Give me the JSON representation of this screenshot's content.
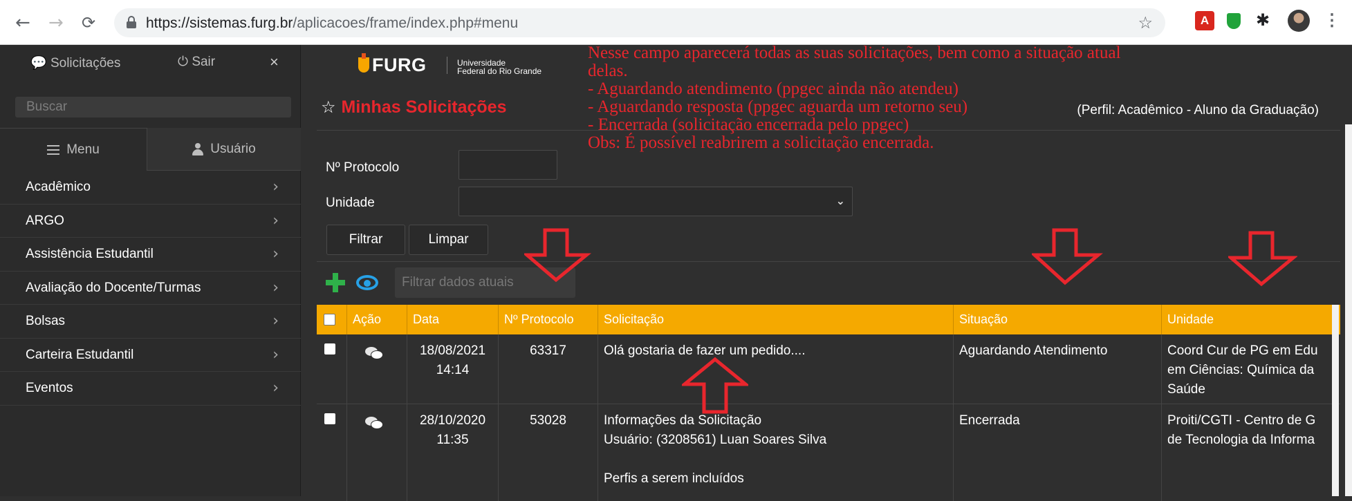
{
  "browser": {
    "url_host": "https://sistemas.furg.br",
    "url_path": "/aplicacoes/frame/index.php#menu",
    "pdf_ext_label": "A"
  },
  "sidebar": {
    "solicitacoes_label": "Solicitações",
    "sair_label": "Sair",
    "close_glyph": "×",
    "search_placeholder": "Buscar",
    "tab_menu": "Menu",
    "tab_usuario": "Usuário",
    "items": [
      {
        "label": "Acadêmico"
      },
      {
        "label": "ARGO"
      },
      {
        "label": "Assistência Estudantil"
      },
      {
        "label": "Avaliação do Docente/Turmas"
      },
      {
        "label": "Bolsas"
      },
      {
        "label": "Carteira Estudantil"
      },
      {
        "label": "Eventos"
      }
    ]
  },
  "header": {
    "logo_text": "FURG",
    "university_line1": "Universidade",
    "university_line2": "Federal do Rio Grande",
    "page_title": "Minhas Solicitações",
    "perfil": "(Perfil: Acadêmico - Aluno da Graduação)"
  },
  "filters": {
    "protocolo_label": "Nº Protocolo",
    "protocolo_value": "",
    "unidade_label": "Unidade",
    "unidade_value": "",
    "filtrar_label": "Filtrar",
    "limpar_label": "Limpar",
    "data_filter_placeholder": "Filtrar dados atuais"
  },
  "table": {
    "columns": [
      "Ação",
      "Data",
      "Nº Protocolo",
      "Solicitação",
      "Situação",
      "Unidade"
    ],
    "rows": [
      {
        "date": "18/08/2021",
        "time": "14:14",
        "protocolo": "63317",
        "solicitacao": [
          "Olá gostaria de fazer um pedido...."
        ],
        "situacao": "Aguardando Atendimento",
        "unidade": [
          "Coord Cur de PG em Edu",
          "em Ciências: Química da",
          "Saúde"
        ]
      },
      {
        "date": "28/10/2020",
        "time": "11:35",
        "protocolo": "53028",
        "solicitacao": [
          "Informações da Solicitação",
          "Usuário: (3208561) Luan Soares Silva",
          "",
          "Perfis a serem incluídos"
        ],
        "situacao": "Encerrada",
        "unidade": [
          "Proiti/CGTI - Centro de G",
          "de Tecnologia da Informa"
        ]
      }
    ]
  },
  "annotation": {
    "lines": [
      "Nesse campo aparecerá todas as suas solicitações, bem como a situação atual",
      "delas.",
      "- Aguardando atendimento (ppgec ainda não atendeu)",
      "- Aguardando resposta (ppgec aguarda um retorno seu)",
      "- Encerrada (solicitação encerrada pelo ppgec)",
      "Obs: É possível reabrirem a solicitação encerrada."
    ],
    "color": "#e8262d"
  },
  "colors": {
    "header_accent": "#f5a900",
    "title_red": "#e8262d",
    "add_green": "#2fb14a",
    "eye_blue": "#27a1e6"
  }
}
